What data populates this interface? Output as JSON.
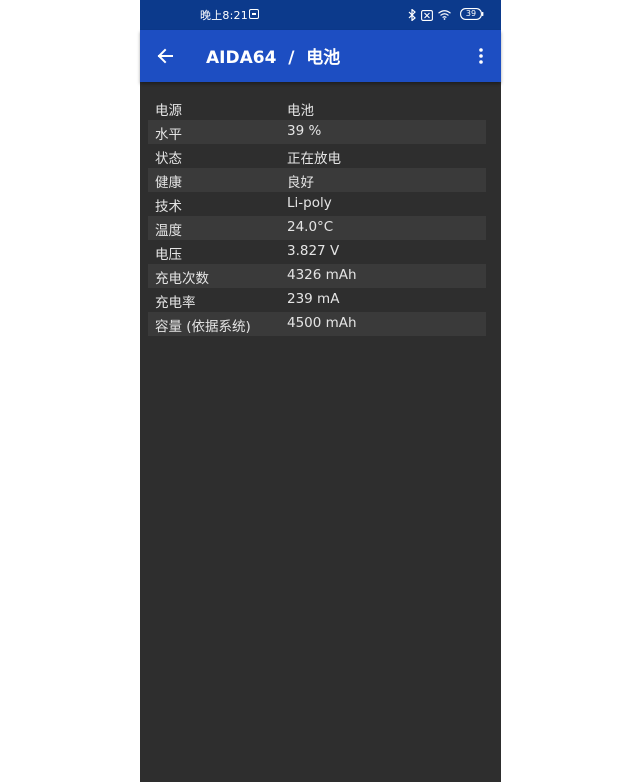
{
  "status_bar": {
    "time": "晚上8:21",
    "battery_level": "39"
  },
  "app_bar": {
    "title": "AIDA64  /  电池"
  },
  "rows": [
    {
      "label": "电源",
      "value": "电池"
    },
    {
      "label": "水平",
      "value": "39 %"
    },
    {
      "label": "状态",
      "value": "正在放电"
    },
    {
      "label": "健康",
      "value": "良好"
    },
    {
      "label": "技术",
      "value": "Li-poly"
    },
    {
      "label": "温度",
      "value": "24.0°C"
    },
    {
      "label": "电压",
      "value": "3.827 V"
    },
    {
      "label": "充电次数",
      "value": "4326 mAh"
    },
    {
      "label": "充电率",
      "value": "239 mA"
    },
    {
      "label": "容量 (依据系统)",
      "value": "4500 mAh"
    }
  ],
  "colors": {
    "status_bar_bg": "#0c3a8c",
    "app_bar_bg": "#1d4ec2",
    "content_bg": "#2e2e2e",
    "row_alt_bg": "#3a3a3a"
  }
}
